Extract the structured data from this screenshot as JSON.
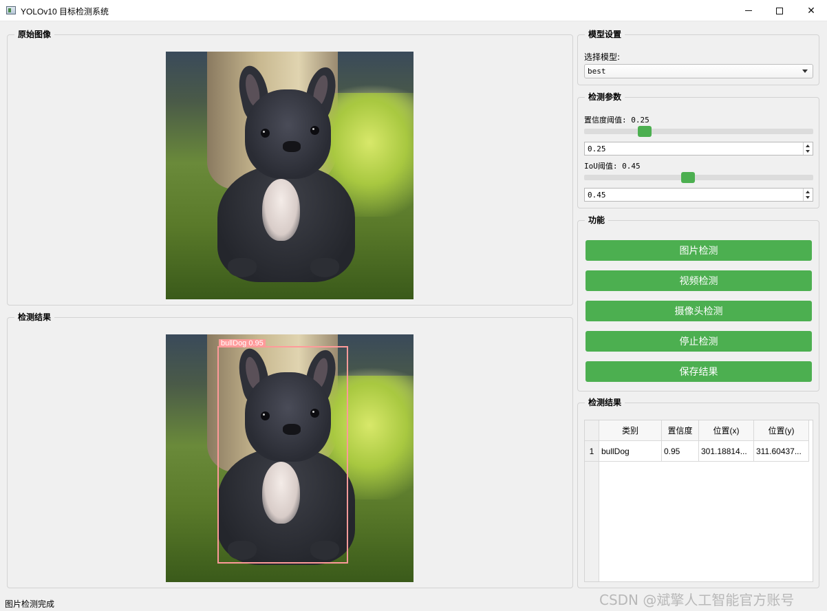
{
  "window": {
    "title": "YOLOv10 目标检测系统",
    "min_glyph": "",
    "max_glyph": "",
    "close_glyph": "✕"
  },
  "original_panel": {
    "title": "原始图像"
  },
  "result_panel": {
    "title": "检测结果",
    "detection_label": "bullDog  0.95"
  },
  "model_settings": {
    "title": "模型设置",
    "select_label": "选择模型:",
    "selected_model": "best"
  },
  "detect_params": {
    "title": "检测参数",
    "confidence_label": "置信度阈值: 0.25",
    "confidence_value": "0.25",
    "confidence_fraction": 0.25,
    "iou_label": "IoU阈值: 0.45",
    "iou_value": "0.45",
    "iou_fraction": 0.45
  },
  "functions": {
    "title": "功能",
    "buttons": [
      "图片检测",
      "视频检测",
      "摄像头检测",
      "停止检测",
      "保存结果"
    ]
  },
  "results_table": {
    "title": "检测结果",
    "columns": [
      "类别",
      "置信度",
      "位置(x)",
      "位置(y)"
    ],
    "rows": [
      {
        "index": "1",
        "cells": [
          "bullDog",
          "0.95",
          "301.18814...",
          "311.60437..."
        ]
      }
    ]
  },
  "status": {
    "text": "图片检测完成"
  },
  "watermark": {
    "text": "CSDN @斌擎人工智能官方账号"
  },
  "colors": {
    "accent": "#4caf50",
    "bbox": "#ff9a9a",
    "background": "#f0f0f0"
  },
  "icons": {
    "app": "app-window-icon",
    "minimize": "minimize-icon",
    "maximize": "maximize-icon",
    "close": "close-icon"
  }
}
